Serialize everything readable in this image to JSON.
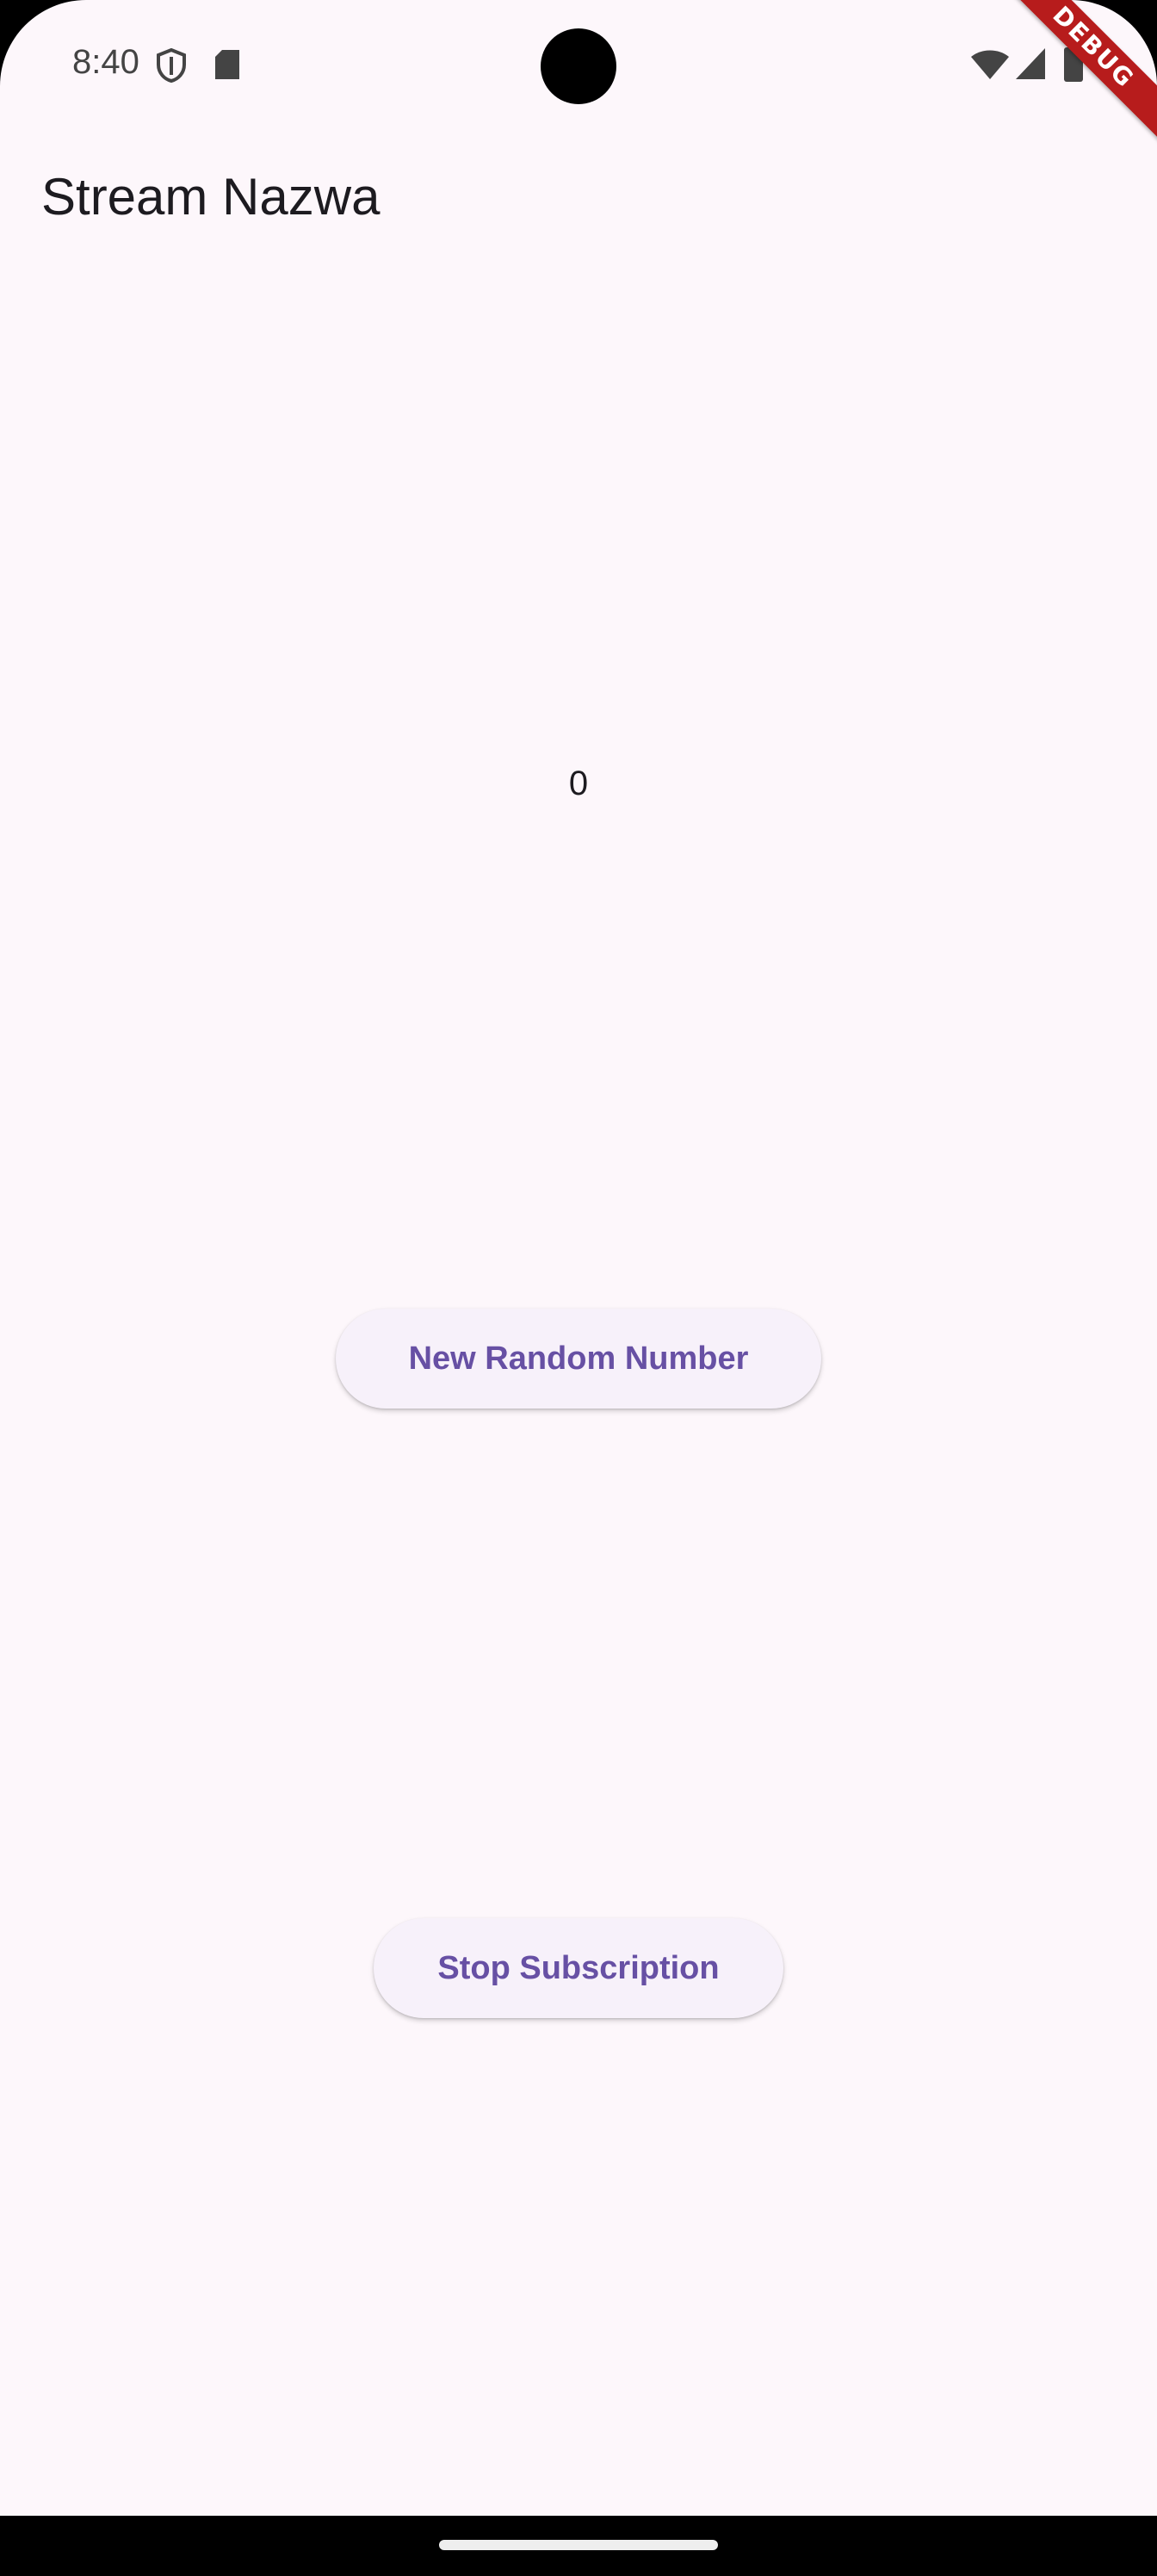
{
  "status_bar": {
    "time": "8:40",
    "icons_left": [
      "shield-icon",
      "sd-card-icon"
    ],
    "icons_right": [
      "wifi-icon",
      "cellular-signal-icon",
      "battery-icon"
    ]
  },
  "debug_banner": "DEBUG",
  "app_bar": {
    "title": "Stream Nazwa"
  },
  "main": {
    "counter_value": "0",
    "new_random_button": "New Random Number",
    "stop_subscription_button": "Stop Subscription"
  },
  "colors": {
    "background": "#fdf7fb",
    "button_background": "#f7f1fa",
    "button_text": "#6750a4",
    "debug_ribbon": "#b71c1c"
  }
}
